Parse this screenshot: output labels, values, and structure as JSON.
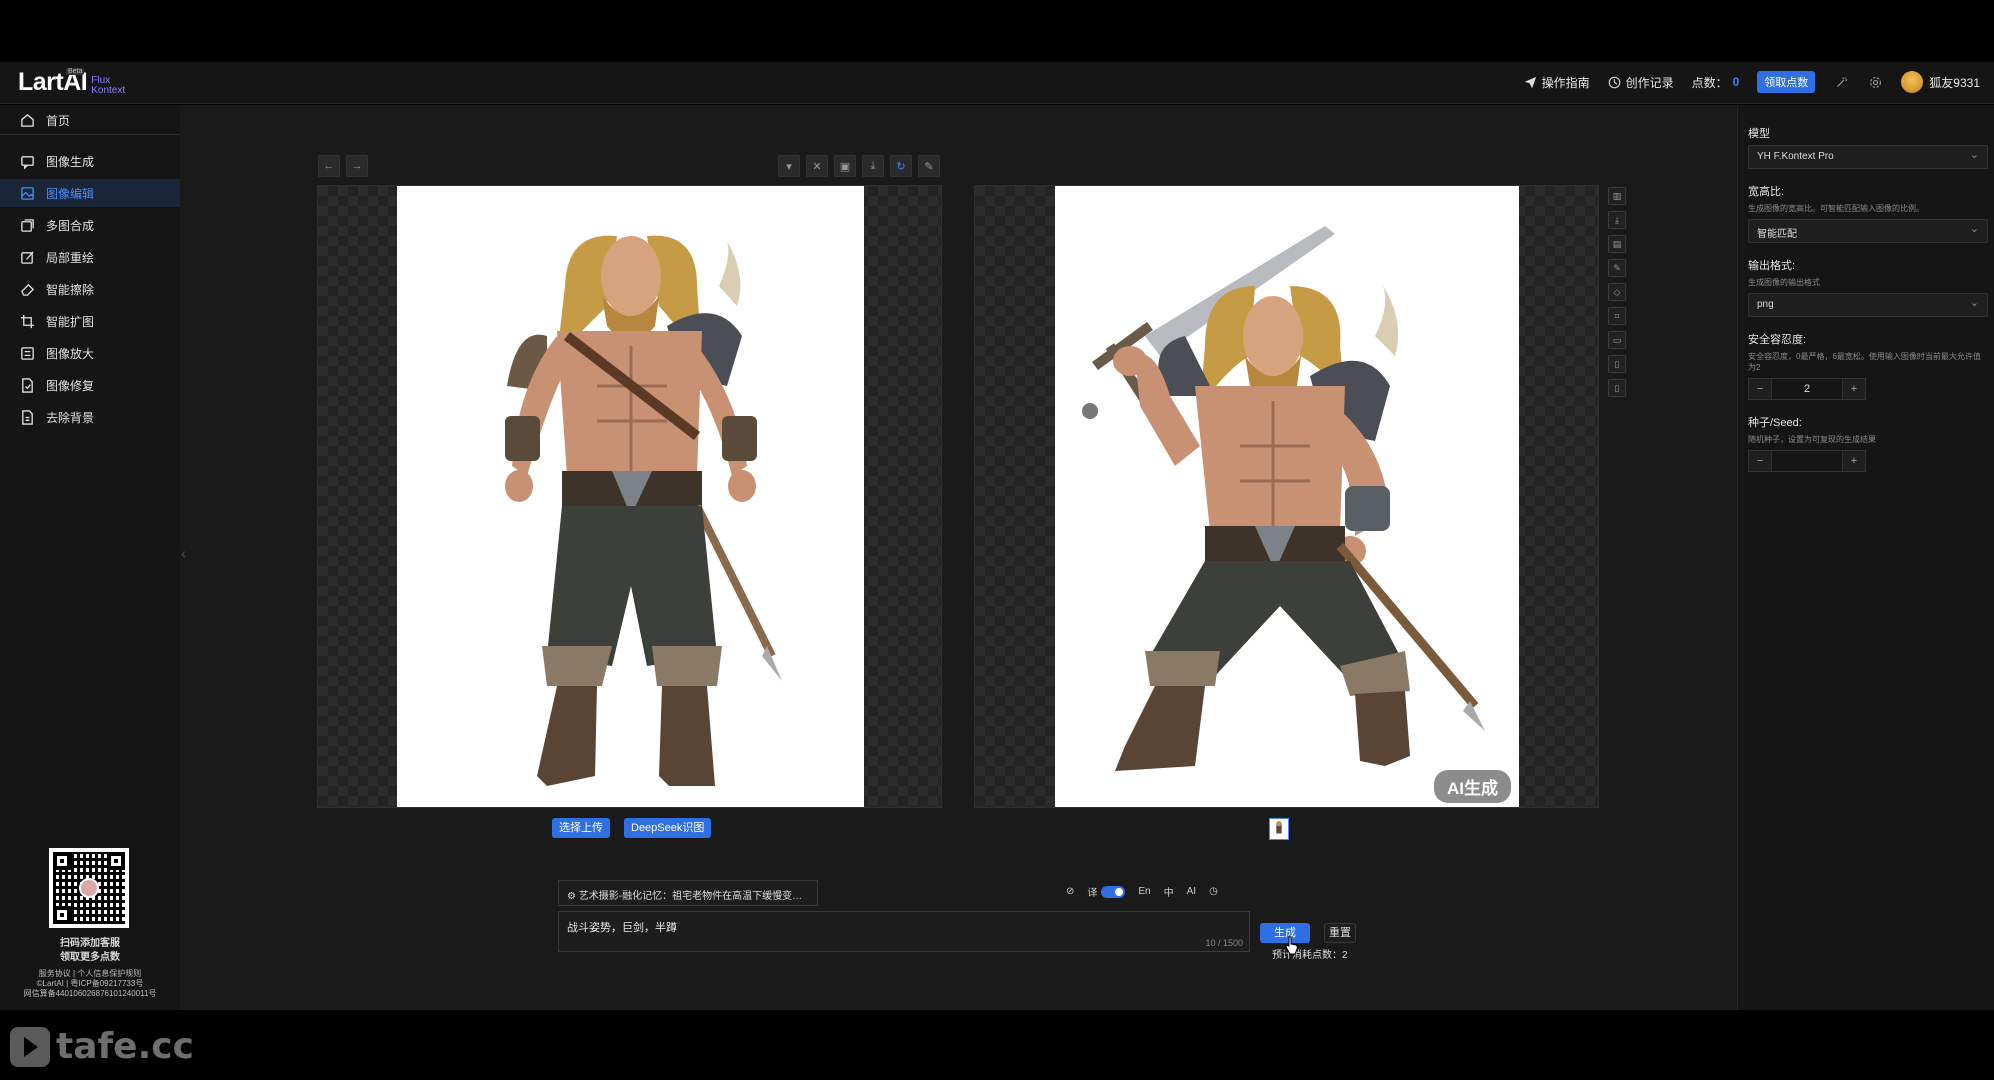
{
  "brand": {
    "name": "LartAI",
    "sub1": "Flux",
    "sub2": "Kontext",
    "badge": "Beta"
  },
  "header": {
    "guide": "操作指南",
    "history": "创作记录",
    "points_label": "点数：",
    "points_value": "0",
    "claim_button": "领取点数",
    "username": "狐友9331"
  },
  "sidebar": {
    "items": [
      {
        "label": "首页",
        "icon": "home-icon"
      },
      {
        "label": "图像生成",
        "icon": "chat-icon"
      },
      {
        "label": "图像编辑",
        "icon": "image-icon",
        "active": true
      },
      {
        "label": "多图合成",
        "icon": "layers-icon"
      },
      {
        "label": "局部重绘",
        "icon": "edit-icon"
      },
      {
        "label": "智能擦除",
        "icon": "eraser-icon"
      },
      {
        "label": "智能扩图",
        "icon": "crop-icon"
      },
      {
        "label": "图像放大",
        "icon": "zoom-icon"
      },
      {
        "label": "图像修复",
        "icon": "repair-icon"
      },
      {
        "label": "去除背景",
        "icon": "remove-bg-icon"
      }
    ],
    "footer": {
      "line1": "扫码添加客服",
      "line2": "领取更多点数",
      "line3": "服务协议 | 个人信息保护规则",
      "line4": "©LartAI | 粤ICP备09217733号",
      "line5": "网信算备440106026876101240011号"
    }
  },
  "editor": {
    "upload_button": "选择上传",
    "deepseek_button": "DeepSeek识图",
    "ai_badge": "AI生成",
    "preset_text": "艺术摄影-融化记忆：祖宅老物件在高温下缓慢变形。...",
    "translate_label": "译",
    "lang_en": "En",
    "lang_zh": "中",
    "ai_label": "AI",
    "prompt_value": "战斗姿势，巨剑，半蹲",
    "prompt_count": "10 / 1500",
    "generate_button": "生成",
    "reset_button": "重置",
    "cost_text": "预计消耗点数：2"
  },
  "settings": {
    "model_label": "模型",
    "model_value": "YH F.Kontext Pro",
    "ratio_label": "宽高比:",
    "ratio_desc": "生成图像的宽高比。可智能匹配输入图像的比例。",
    "ratio_value": "智能匹配",
    "format_label": "输出格式:",
    "format_desc": "生成图像的输出格式",
    "format_value": "png",
    "safety_label": "安全容忍度:",
    "safety_desc": "安全容忍度，0最严格，6最宽松。使用输入图像时当前最大允许值为2",
    "safety_value": "2",
    "seed_label": "种子/Seed:",
    "seed_desc": "随机种子，设置为可复现的生成结果",
    "seed_value": ""
  },
  "watermark": "tafe.cc",
  "colors": {
    "accent": "#2f6fe4",
    "active_nav_bg": "#1a2638",
    "background": "#1a1a1a"
  }
}
